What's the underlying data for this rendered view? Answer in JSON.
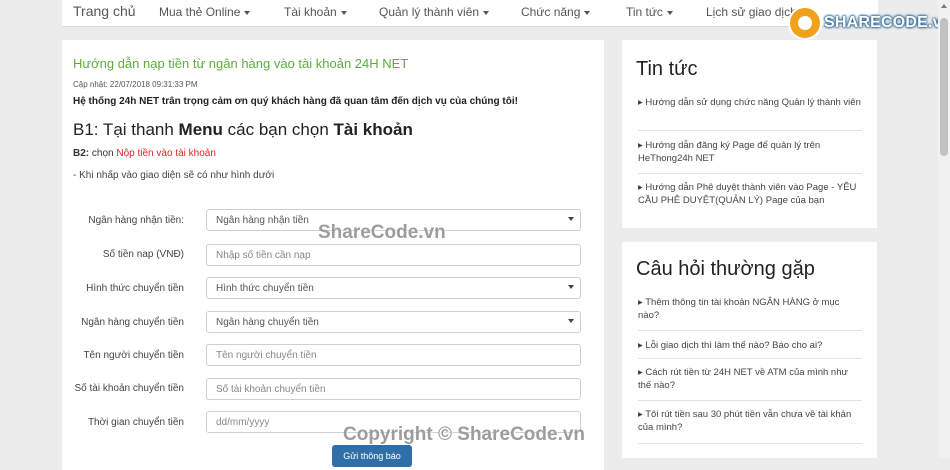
{
  "nav": {
    "brand": "Trang chủ",
    "items": [
      "Mua thẻ Online",
      "Tài khoản",
      "Quản lý thành viên",
      "Chức năng",
      "Tin tức",
      "Lịch sử giao dịch"
    ]
  },
  "logo": {
    "text": "SHARECODE.vn"
  },
  "article": {
    "title": "Hướng dẫn nạp tiền từ ngân hàng vào tài khoản 24H NET",
    "updated": "Cập nhật: 22/07/2018 09:31:33 PM",
    "thanks": "Hệ thống 24h NET trân trọng cảm ơn quý khách hàng đã quan tâm đến dịch vụ của chúng tôi!",
    "step1_prefix": "B1: Tại thanh ",
    "step1_menu": "Menu",
    "step1_middle": " các bạn chọn ",
    "step1_account": "Tài khoản",
    "step2_label": "B2:",
    "step2_text": " chọn ",
    "step2_link": "Nộp tiền vào tài khoản",
    "hint": "- Khi nhấp vào giao diện sẽ có như hình dưới"
  },
  "form": {
    "fields": [
      {
        "label": "Ngân hàng nhận tiền:",
        "value": "Ngân hàng nhận tiền",
        "type": "select"
      },
      {
        "label": "Số tiền nap (VNĐ)",
        "value": "Nhập số tiền cần nạp",
        "type": "input"
      },
      {
        "label": "Hình thức chuyển tiền",
        "value": "Hình thức chuyển tiền",
        "type": "select"
      },
      {
        "label": "Ngân hàng chuyển tiền",
        "value": "Ngân hàng chuyển tiền",
        "type": "select"
      },
      {
        "label": "Tên người chuyển tiền",
        "value": "Tên người chuyển tiền",
        "type": "input"
      },
      {
        "label": "Số tài khoản chuyển tiền",
        "value": "Số tài khoản chuyển tiền",
        "type": "input"
      },
      {
        "label": "Thời gian chuyển tiền",
        "value": "dd/mm/yyyy",
        "type": "input"
      }
    ],
    "submit": "Gửi thông báo"
  },
  "watermarks": [
    "ShareCode.vn",
    "Copyright © ShareCode.vn"
  ],
  "sidebar": {
    "news_title": "Tin tức",
    "news": [
      "▸ Hướng dẫn sử dụng chức năng Quản lý thành viên",
      "▸ Hướng dẫn đăng ký Page để quản lý trên HeThong24h NET",
      "▸ Hướng dẫn Phê duyệt thành viên vào Page - YÊU CẦU PHÊ DUYỆT(QUẢN LÝ) Page của bạn"
    ],
    "faq_title": "Câu hỏi thường gặp",
    "faq": [
      "▸ Thêm thông tin tài khoản NGÂN HÀNG ở mục nào?",
      "▸ Lỗi giao dịch thì làm thế nào? Báo cho ai?",
      "▸ Cách rút tiền từ 24H NET về ATM của mình như thế nào?",
      "▸ Tôi rút tiền sau 30 phút tiền vẫn chưa về tài khản của mình?"
    ]
  },
  "colors": {
    "title_green": "#5cad3e",
    "link_red": "#e02424",
    "button_blue": "#2f6fa7",
    "logo_orange": "#f0a21a"
  }
}
